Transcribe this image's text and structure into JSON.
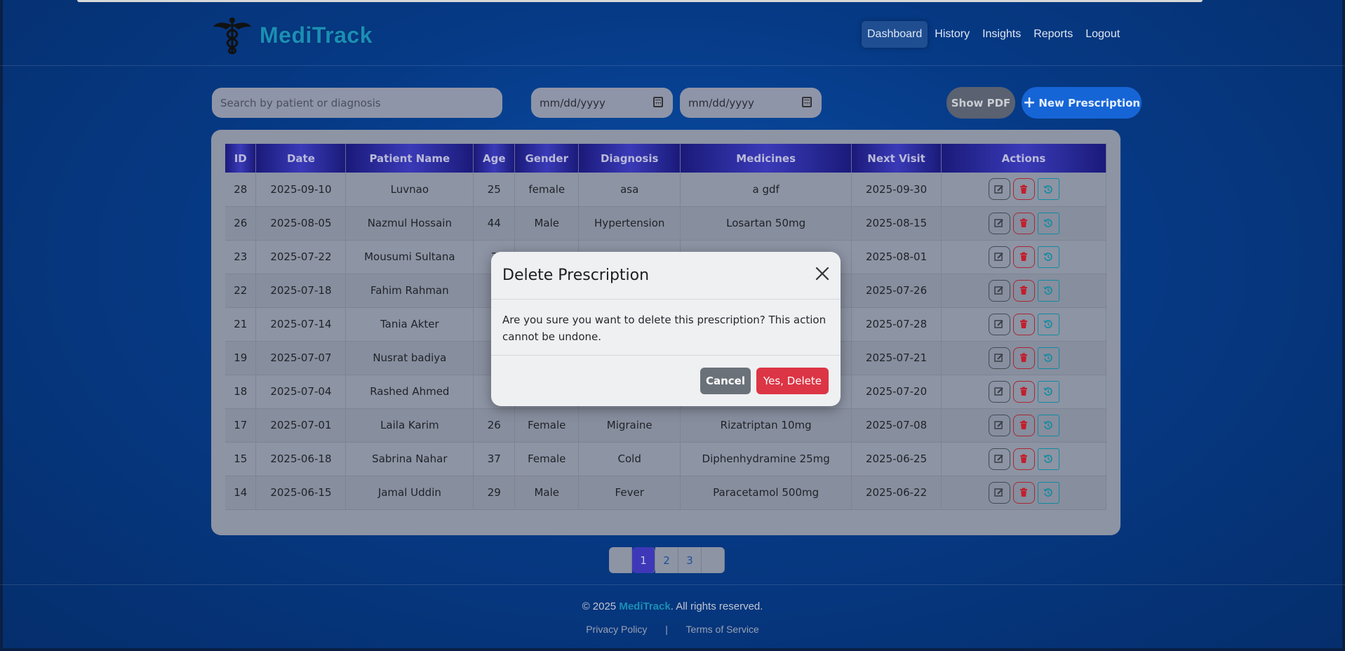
{
  "header": {
    "brand": "MediTrack",
    "nav": [
      {
        "label": "Dashboard",
        "active": true
      },
      {
        "label": "History",
        "active": false
      },
      {
        "label": "Insights",
        "active": false
      },
      {
        "label": "Reports",
        "active": false
      },
      {
        "label": "Logout",
        "active": false
      }
    ]
  },
  "toolbar": {
    "search_placeholder": "Search by patient or diagnosis",
    "date_from": "mm/dd/yyyy",
    "date_to": "mm/dd/yyyy",
    "show_pdf_label": "Show PDF",
    "new_prescription_label": "New Prescription",
    "new_prescription_icon": "plus-icon"
  },
  "table": {
    "columns": [
      "ID",
      "Date",
      "Patient Name",
      "Age",
      "Gender",
      "Diagnosis",
      "Medicines",
      "Next Visit",
      "Actions"
    ],
    "rows": [
      {
        "id": "28",
        "date": "2025-09-10",
        "patient": "Luvnao",
        "age": "25",
        "gender": "female",
        "diagnosis": "asa",
        "medicines": "a gdf",
        "next_visit": "2025-09-30"
      },
      {
        "id": "26",
        "date": "2025-08-05",
        "patient": "Nazmul Hossain",
        "age": "44",
        "gender": "Male",
        "diagnosis": "Hypertension",
        "medicines": "Losartan 50mg",
        "next_visit": "2025-08-15"
      },
      {
        "id": "23",
        "date": "2025-07-22",
        "patient": "Mousumi Sultana",
        "age": "3",
        "gender": "",
        "diagnosis": "",
        "medicines": "",
        "next_visit": "2025-08-01"
      },
      {
        "id": "22",
        "date": "2025-07-18",
        "patient": "Fahim Rahman",
        "age": "4",
        "gender": "",
        "diagnosis": "",
        "medicines": "",
        "next_visit": "2025-07-26"
      },
      {
        "id": "21",
        "date": "2025-07-14",
        "patient": "Tania Akter",
        "age": "",
        "gender": "",
        "diagnosis": "",
        "medicines": "",
        "next_visit": "2025-07-28"
      },
      {
        "id": "19",
        "date": "2025-07-07",
        "patient": "Nusrat badiya",
        "age": "",
        "gender": "",
        "diagnosis": "",
        "medicines": "",
        "next_visit": "2025-07-21"
      },
      {
        "id": "18",
        "date": "2025-07-04",
        "patient": "Rashed Ahmed",
        "age": "",
        "gender": "",
        "diagnosis": "",
        "medicines": "",
        "next_visit": "2025-07-20"
      },
      {
        "id": "17",
        "date": "2025-07-01",
        "patient": "Laila Karim",
        "age": "26",
        "gender": "Female",
        "diagnosis": "Migraine",
        "medicines": "Rizatriptan 10mg",
        "next_visit": "2025-07-08"
      },
      {
        "id": "15",
        "date": "2025-06-18",
        "patient": "Sabrina Nahar",
        "age": "37",
        "gender": "Female",
        "diagnosis": "Cold",
        "medicines": "Diphenhydramine 25mg",
        "next_visit": "2025-06-25"
      },
      {
        "id": "14",
        "date": "2025-06-15",
        "patient": "Jamal Uddin",
        "age": "29",
        "gender": "Male",
        "diagnosis": "Fever",
        "medicines": "Paracetamol 500mg",
        "next_visit": "2025-06-22"
      }
    ],
    "action_icons": [
      "edit-icon",
      "trash-icon",
      "history-icon"
    ]
  },
  "pagination": {
    "pages": [
      "1",
      "2",
      "3"
    ],
    "current": "1"
  },
  "footer": {
    "copyright_prefix": "© 2025",
    "brand": "MediTrack",
    "copyright_suffix": ". All rights reserved.",
    "links": [
      "Privacy Policy",
      "Terms of Service"
    ],
    "separator": "|"
  },
  "modal": {
    "title": "Delete Prescription",
    "message": "Are you sure you want to delete this prescription? This action cannot be undone.",
    "cancel_label": "Cancel",
    "confirm_label": "Yes, Delete"
  },
  "colors": {
    "brand": "#1a8fb5",
    "primary": "#1665d6",
    "danger": "#dc3545",
    "secondary": "#6b7179"
  }
}
